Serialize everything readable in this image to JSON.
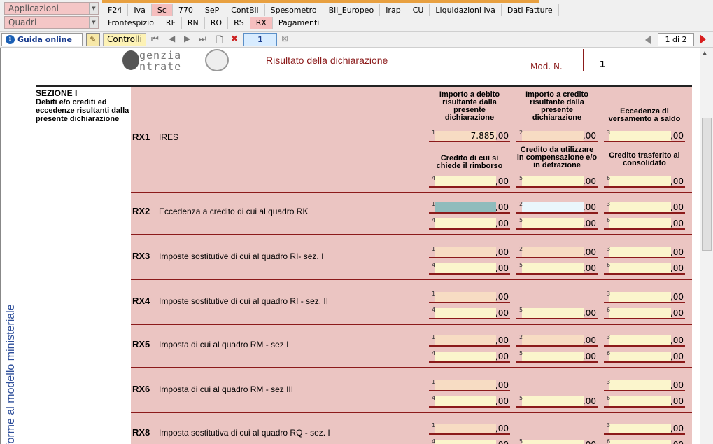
{
  "menu": {
    "combo1": "Applicazioni",
    "combo2": "Quadri",
    "tabs1": [
      "F24",
      "Iva",
      "Sc",
      "770",
      "SeP",
      "ContBil",
      "Spesometro",
      "Bil_Europeo",
      "Irap",
      "CU",
      "Liquidazioni Iva",
      "Dati Fatture"
    ],
    "tabs1_selected": 2,
    "tabs2": [
      "Frontespizio",
      "RF",
      "RN",
      "RO",
      "RS",
      "RX",
      "Pagamenti"
    ],
    "tabs2_selected": 5
  },
  "toolbar": {
    "guide_label": "Guida online",
    "controls_label": "Controlli",
    "page_value": "1",
    "page_of": "1 di 2"
  },
  "doc": {
    "logo_line1": "genzia",
    "logo_line2": "ntrate",
    "title": "Risultato della dichiarazione",
    "mod_label": "Mod. N.",
    "mod_value": "1",
    "section_title": "SEZIONE I",
    "section_sub": "Debiti e/o crediti ed eccedenze risultanti dalla presente dichiarazione",
    "side_vertical": "forme al modello ministeriale",
    "col1_header": "Importo a debito risultante dalla presente dichiarazione",
    "col2_header": "Importo a credito risultante dalla presente dichiarazione",
    "col3_header": "Eccedenza di versamento a saldo",
    "col4_header": "Credito di cui si chiede il rimborso",
    "col5_header": "Credito da utilizzare in compensazione e/o in detrazione",
    "col6_header": "Credito trasferito al consolidato",
    "decimal_suffix": ",00",
    "rows": [
      {
        "code": "RX1",
        "desc": "IRES",
        "v1": "7.885"
      },
      {
        "code": "RX2",
        "desc": "Eccedenza a credito di cui al quadro RK",
        "v1": ""
      },
      {
        "code": "RX3",
        "desc": "Imposte sostitutive di cui al quadro RI- sez. I",
        "v1": ""
      },
      {
        "code": "RX4",
        "desc": "Imposte sostitutive di cui al quadro RI - sez. II",
        "v1": ""
      },
      {
        "code": "RX5",
        "desc": "Imposta di cui al quadro RM - sez I",
        "v1": ""
      },
      {
        "code": "RX6",
        "desc": "Imposta di cui al quadro RM - sez III",
        "v1": ""
      },
      {
        "code": "RX8",
        "desc": "Imposta sostitutiva di cui al quadro RQ - sez. I",
        "v1": ""
      }
    ]
  },
  "colors": {
    "pink_bg": "#ebc5c2",
    "dark_red": "#8b1a1a",
    "field_peach": "#f7dcc3",
    "field_yellow": "#fbf5cc",
    "field_teal": "#8fbcbc",
    "field_light": "#eaf6fb"
  }
}
